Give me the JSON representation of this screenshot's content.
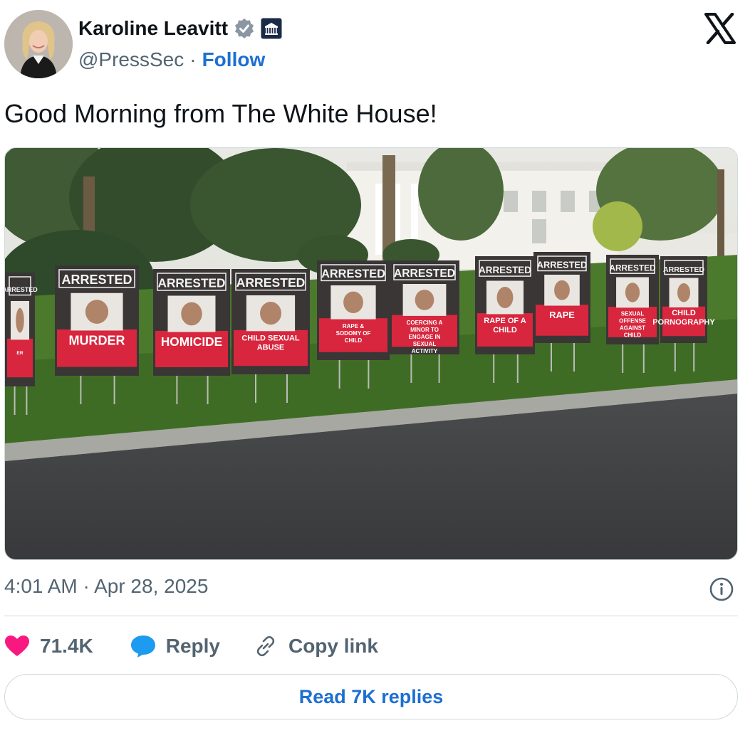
{
  "author": {
    "name": "Karoline Leavitt",
    "handle": "@PressSec",
    "separator": "·",
    "follow_label": "Follow",
    "verified_icon": "verified-badge-icon",
    "affiliation_icon": "white-house-affiliate-icon"
  },
  "tweet": {
    "text": "Good Morning from The White House!",
    "timestamp": "4:01 AM · Apr 28, 2025"
  },
  "media": {
    "signs": [
      {
        "header": "ARRESTED",
        "crime": "ER"
      },
      {
        "header": "ARRESTED",
        "crime": "MURDER"
      },
      {
        "header": "ARRESTED",
        "crime": "HOMICIDE"
      },
      {
        "header": "ARRESTED",
        "crime": "CHILD SEXUAL ABUSE"
      },
      {
        "header": "ARRESTED",
        "crime": "RAPE & SODOMY OF CHILD"
      },
      {
        "header": "ARRESTED",
        "crime": "COERCING A MINOR TO ENGAGE IN SEXUAL ACTIVITY"
      },
      {
        "header": "ARRESTED",
        "crime": "RAPE OF A CHILD"
      },
      {
        "header": "ARRESTED",
        "crime": "RAPE"
      },
      {
        "header": "ARRESTED",
        "crime": "SEXUAL OFFENSE AGAINST CHILD"
      },
      {
        "header": "ARRESTED",
        "crime": "CHILD PORNOGRAPHY"
      }
    ]
  },
  "actions": {
    "like_count": "71.4K",
    "reply_label": "Reply",
    "copy_link_label": "Copy link",
    "read_replies_label": "Read 7K replies"
  },
  "colors": {
    "accent": "#1d6fd1",
    "like": "#f91880",
    "reply_bubble": "#1d9bf0",
    "sign_red": "#d7263d",
    "sign_dark": "#3a3636"
  }
}
